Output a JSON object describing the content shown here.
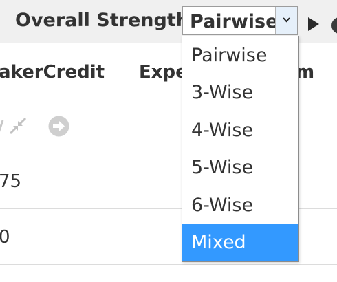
{
  "toolbar": {
    "strength_label": "Overall Strength:",
    "select": {
      "value": "Pairwise",
      "icon": "chevron-down-icon"
    },
    "run_icon": "play-icon"
  },
  "table": {
    "headers": [
      "akerCredit",
      "Expe",
      "m"
    ],
    "toolbar_icons": [
      "collapse-icon",
      "arrow-right-circle-icon"
    ],
    "rows": [
      {
        "value": "75"
      },
      {
        "value": "0"
      }
    ]
  },
  "dropdown": {
    "options": [
      "Pairwise",
      "3-Wise",
      "4-Wise",
      "5-Wise",
      "6-Wise",
      "Mixed"
    ],
    "highlighted": "Mixed",
    "highlight_color": "#3399ff"
  }
}
